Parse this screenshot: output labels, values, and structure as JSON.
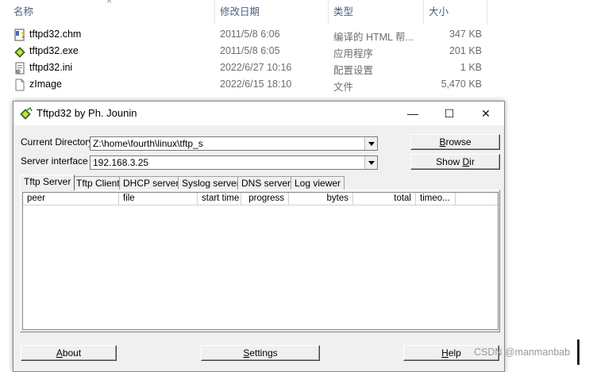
{
  "explorer": {
    "columns": {
      "name": "名称",
      "date": "修改日期",
      "type": "类型",
      "size": "大小"
    },
    "sort_indicator": "^",
    "files": [
      {
        "name": "tftpd32.chm",
        "date": "2011/5/8 6:06",
        "type": "编译的 HTML 帮...",
        "size": "347 KB",
        "icon": "chm-help-icon"
      },
      {
        "name": "tftpd32.exe",
        "date": "2011/5/8 6:05",
        "type": "应用程序",
        "size": "201 KB",
        "icon": "tftpd-exe-icon"
      },
      {
        "name": "tftpd32.ini",
        "date": "2022/6/27 10:16",
        "type": "配置设置",
        "size": "1 KB",
        "icon": "ini-settings-icon"
      },
      {
        "name": "zImage",
        "date": "2022/6/15 18:10",
        "type": "文件",
        "size": "5,470 KB",
        "icon": "blank-file-icon"
      }
    ]
  },
  "window": {
    "title": "Tftpd32 by Ph. Jounin",
    "controls": {
      "minimize": "—",
      "maximize": "☐",
      "close": "✕"
    },
    "current_directory_label": "Current Directory",
    "current_directory_value": "Z:\\home\\fourth\\linux\\tftp_s",
    "server_interface_label": "Server interface",
    "server_interface_value": "192.168.3.25",
    "browse": {
      "pre": "",
      "u": "B",
      "post": "rowse"
    },
    "show_dir": {
      "pre": "Show ",
      "u": "D",
      "post": "ir"
    },
    "tabs": [
      "Tftp Server",
      "Tftp Client",
      "DHCP server",
      "Syslog server",
      "DNS server",
      "Log viewer"
    ],
    "active_tab": "Tftp Server",
    "list_columns": [
      "peer",
      "file",
      "start time",
      "progress",
      "bytes",
      "total",
      "timeo..."
    ],
    "about": {
      "pre": "",
      "u": "A",
      "post": "bout"
    },
    "settings": {
      "pre": "",
      "u": "S",
      "post": "ettings"
    },
    "help": {
      "pre": "",
      "u": "H",
      "post": "elp"
    }
  },
  "watermark": "CSDN @manmanbab",
  "colors": {
    "explorer_header_text": "#4c607a",
    "window_background": "#f0f0f0",
    "list_background": "#ffffff"
  }
}
